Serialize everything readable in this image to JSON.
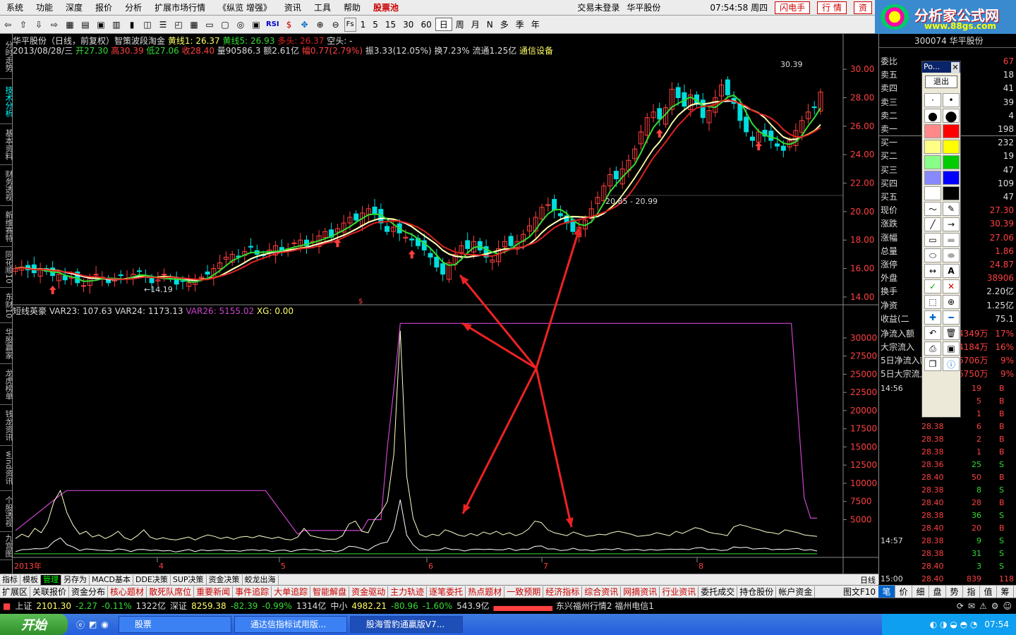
{
  "menubar": {
    "items": [
      "系统",
      "功能",
      "深度",
      "报价",
      "分析",
      "扩展市场行情",
      "《纵览 增强》",
      "资讯",
      "工具",
      "帮助"
    ],
    "highlight": "股票池",
    "login": "交易未登录",
    "stock_name": "华平股份",
    "clock": "07:54:58 周四",
    "btn_flash": "闪电手",
    "btn_quote": "行 情",
    "btn_asset": "资"
  },
  "logo": {
    "title": "分析家公式网",
    "url": "www.88gs.com"
  },
  "toolbar": {
    "periods": [
      "1",
      "5",
      "15",
      "30",
      "60",
      "日",
      "周",
      "月",
      "N",
      "多",
      "季",
      "年"
    ],
    "selected": "日",
    "rsi": "RSI",
    "fs": "Fs"
  },
  "left_tabs": [
    "分时走势",
    "技术分析",
    "基本资料",
    "财务透视",
    "新维赛特",
    "同花顺10",
    "东财10",
    "华股赢家",
    "龙虎榜单",
    "钱龙资讯",
    "wind资讯",
    "个股透视",
    "九宫图"
  ],
  "main_info": {
    "line1_prefix": "华平股份（日线，前复权）智策波段淘金",
    "huang1": "黄线1: 26.37",
    "huang5": "黄线5: 26.93",
    "duotou": "多头: 26.37",
    "kongtou": "空头: -",
    "date": "2013/08/28/三",
    "open": "开27.30",
    "high": "高30.39",
    "low": "低27.06",
    "close": "收28.40",
    "vol": "量90586.3",
    "amount": "额2.61亿",
    "change": "幅0.77(2.79%)",
    "amp": "振3.33(12.05%)",
    "turnover": "换7.23%",
    "float": "流通1.25亿",
    "industry": "通信设备"
  },
  "sub_info": {
    "name": "短线英豪",
    "var23": "VAR23: 107.63",
    "var24": "VAR24: 1173.13",
    "var26": "VAR26: 5155.02",
    "xg": "XG: 0.00"
  },
  "annotations": {
    "peak": "30.39",
    "low1": "14.19",
    "range": "20.85 - 20.99"
  },
  "colors": {
    "yellow": "#ffff66",
    "green": "#33dd33",
    "red": "#dd2222",
    "white": "#ffffff",
    "magenta": "#cc44cc",
    "up": "#ff4040",
    "down": "#00dddd",
    "arrow": "#ee2222"
  },
  "chart_data": [
    {
      "type": "candlestick",
      "title": "华平股份（日线，前复权）",
      "ylim": [
        13.5,
        31
      ],
      "y_ticks": [
        "14.00",
        "16.00",
        "18.00",
        "20.00",
        "22.00",
        "24.00",
        "26.00",
        "28.00",
        "30.00"
      ],
      "x_labels": [
        "2013年",
        "4",
        "5",
        "6",
        "7",
        "8"
      ],
      "closes": [
        16.0,
        16.1,
        15.9,
        15.7,
        16.0,
        15.8,
        15.5,
        15.6,
        15.2,
        15.4,
        15.0,
        14.8,
        15.3,
        15.6,
        15.4,
        15.0,
        15.2,
        15.5,
        15.3,
        15.6,
        15.8,
        15.4,
        15.0,
        15.2,
        15.6,
        15.3,
        14.9,
        15.1,
        15.0,
        15.2,
        15.4,
        15.6,
        16.0,
        16.4,
        16.8,
        17.0,
        16.8,
        17.2,
        17.5,
        17.0,
        16.9,
        17.3,
        17.6,
        17.2,
        17.4,
        17.8,
        18.0,
        17.6,
        17.9,
        18.3,
        18.6,
        18.2,
        18.8,
        19.2,
        19.6,
        19.4,
        19.9,
        20.2,
        19.8,
        19.2,
        18.6,
        18.9,
        18.5,
        18.2,
        18.0,
        17.6,
        17.3,
        16.8,
        16.1,
        15.6,
        16.4,
        17.0,
        17.6,
        17.4,
        17.9,
        17.3,
        16.8,
        16.6,
        17.4,
        17.9,
        17.6,
        17.9,
        18.4,
        19.0,
        19.6,
        20.3,
        20.5,
        20.1,
        19.7,
        19.2,
        18.6,
        18.9,
        19.4,
        20.2,
        21.0,
        21.8,
        22.6,
        22.3,
        23.0,
        23.6,
        24.4,
        25.6,
        26.6,
        27.0,
        26.5,
        27.3,
        28.6,
        28.0,
        27.4,
        28.2,
        27.6,
        26.6,
        27.1,
        28.0,
        28.9,
        28.2,
        27.6,
        26.4,
        25.6,
        25.0,
        25.6,
        25.3,
        25.0,
        24.6,
        24.3,
        25.0,
        25.7,
        26.4,
        27.0,
        27.3,
        28.4
      ],
      "series": [
        {
          "name": "黄线1",
          "values_ref": "ma_yellow"
        },
        {
          "name": "黄线5",
          "values_ref": "ma_green"
        },
        {
          "name": "多头",
          "values_ref": "ma_red"
        }
      ]
    },
    {
      "type": "line",
      "title": "短线英豪",
      "ylim": [
        0,
        33000
      ],
      "y_ticks": [
        "5000",
        "7500",
        "10000",
        "12500",
        "15000",
        "17500",
        "20000",
        "22500",
        "25000",
        "27500",
        "30000"
      ],
      "series": [
        {
          "name": "VAR23",
          "values": [
            2400,
            3000,
            2600,
            3800,
            3200,
            4600,
            7500,
            9000,
            6000,
            4200,
            3000,
            3400,
            2600,
            2900,
            2400,
            2800,
            3400,
            2500,
            2200,
            2800,
            3600,
            2600,
            2300,
            2500,
            2300,
            2200,
            2400,
            2600,
            2200,
            2600,
            2900,
            2700,
            2400,
            2600,
            2300,
            2600,
            2700,
            2500,
            2800,
            2600,
            2400,
            2600,
            2300,
            2200,
            2600,
            3800,
            2800,
            2600,
            2400,
            2300,
            2300,
            2800,
            4400,
            4800,
            3400,
            3200,
            5000,
            6000,
            7500,
            14000,
            31000,
            11000,
            5200,
            3000,
            2600,
            3000,
            2800,
            3600,
            3300,
            2900,
            2700,
            3100,
            2800,
            3300,
            3000,
            3400,
            2900,
            3200,
            2800,
            3100,
            3700,
            4800,
            4600,
            3600,
            3200,
            3000,
            2800,
            3300,
            3000,
            2700,
            2800,
            3000,
            2900,
            3200,
            3400,
            3200,
            3000,
            2700,
            2800,
            2900,
            3200,
            3000,
            2800,
            3400,
            3100,
            3500,
            3900,
            3700,
            3300,
            3100,
            3000,
            2800,
            4000,
            4300,
            4100,
            3800,
            3600,
            3300,
            3200,
            3000,
            3600,
            3400,
            3200,
            2900,
            2800,
            2700
          ]
        },
        {
          "name": "VAR24",
          "values_ref": "var24"
        },
        {
          "name": "VAR26",
          "values_ref": "var26"
        }
      ]
    }
  ],
  "right_panel": {
    "code": "300074",
    "name": "华平股份",
    "rows": [
      {
        "label": "委比",
        "value": "67",
        "color": "#ff4040"
      },
      {
        "label": "卖五",
        "value": "18",
        "color": "#ddd"
      },
      {
        "label": "卖四",
        "value": "41",
        "color": "#ddd"
      },
      {
        "label": "卖三",
        "value": "39",
        "color": "#ddd"
      },
      {
        "label": "卖二",
        "value": "4",
        "color": "#ddd"
      },
      {
        "label": "卖一",
        "value": "198",
        "color": "#ddd"
      },
      {
        "label": "买一",
        "value": "232",
        "color": "#ddd"
      },
      {
        "label": "买二",
        "value": "19",
        "color": "#ddd"
      },
      {
        "label": "买三",
        "value": "47",
        "color": "#ddd"
      },
      {
        "label": "买四",
        "value": "109",
        "color": "#ddd"
      },
      {
        "label": "买五",
        "value": "47",
        "color": "#ddd"
      },
      {
        "label": "现价",
        "value": "27.30",
        "color": "#ff4040"
      },
      {
        "label": "涨跌",
        "value": "30.39",
        "color": "#ff4040"
      },
      {
        "label": "涨幅",
        "value": "27.06",
        "color": "#ff4040"
      },
      {
        "label": "总量",
        "value": "1.86",
        "color": "#ff4040"
      },
      {
        "label": "涨停",
        "value": "24.87",
        "color": "#ff4040"
      },
      {
        "label": "外盘",
        "value": "38906",
        "color": "#ff4040"
      },
      {
        "label": "换手",
        "value": "2.20亿",
        "color": "#ddd"
      },
      {
        "label": "净资",
        "value": "1.25亿",
        "color": "#ddd"
      },
      {
        "label": "收益(二",
        "value": "75.1",
        "color": "#ddd"
      }
    ],
    "flows": [
      {
        "label": "净流入额",
        "value": "4349万",
        "pct": "17%"
      },
      {
        "label": "大宗流入",
        "value": "4184万",
        "pct": "16%"
      },
      {
        "label": "5日净流入额",
        "value": "6706万",
        "pct": "9%"
      },
      {
        "label": "5日大宗流入",
        "value": "6750万",
        "pct": "9%"
      }
    ],
    "ticks": [
      {
        "t": "14:56",
        "p": "",
        "v": "19",
        "s": "B"
      },
      {
        "t": "",
        "p": "",
        "v": "5",
        "s": "B"
      },
      {
        "t": "",
        "p": "",
        "v": "1",
        "s": "B"
      },
      {
        "t": "",
        "p": "28.38",
        "v": "6",
        "s": "B"
      },
      {
        "t": "",
        "p": "28.38",
        "v": "2",
        "s": "B"
      },
      {
        "t": "",
        "p": "28.38",
        "v": "1",
        "s": "B"
      },
      {
        "t": "",
        "p": "28.36",
        "v": "25",
        "s": "S"
      },
      {
        "t": "",
        "p": "28.40",
        "v": "50",
        "s": "B"
      },
      {
        "t": "",
        "p": "28.38",
        "v": "8",
        "s": "S"
      },
      {
        "t": "",
        "p": "28.40",
        "v": "28",
        "s": "B"
      },
      {
        "t": "",
        "p": "28.38",
        "v": "36",
        "s": "S"
      },
      {
        "t": "",
        "p": "28.40",
        "v": "20",
        "s": "B"
      },
      {
        "t": "14:57",
        "p": "28.38",
        "v": "9",
        "s": "S"
      },
      {
        "t": "",
        "p": "28.38",
        "v": "31",
        "s": "S"
      },
      {
        "t": "",
        "p": "28.40",
        "v": "3",
        "s": "S"
      },
      {
        "t": "15:00",
        "p": "28.40",
        "v": "839",
        "s": "118"
      }
    ]
  },
  "drawing_tool": {
    "title": "Po...",
    "exit": "退出"
  },
  "bottom_tabs": [
    "指标",
    "模板",
    "管理",
    "另存为",
    "MACD基本",
    "DDE决策",
    "SUP决策",
    "资金决策",
    "蛟龙出海"
  ],
  "bottom_tabs_selected": "管理",
  "period_label": "日线",
  "func_bar": [
    "扩展区",
    "关联报价",
    "资金分布",
    "核心题材",
    "散死队席位",
    "重要新闻",
    "事件追踪",
    "大单追踪",
    "智能解盘",
    "资金驱动",
    "主力轨迹",
    "逐笔委托",
    "热点题材",
    "一致预期",
    "经济指标",
    "综合资讯",
    "网摘资讯",
    "行业资讯",
    "委托成交",
    "持仓股份",
    "帐户资金"
  ],
  "func_bar_red": [
    "核心题材",
    "散死队席位",
    "重要新闻",
    "事件追踪",
    "大单追踪",
    "智能解盘",
    "资金驱动",
    "主力轨迹",
    "逐笔委托",
    "热点题材",
    "一致预期",
    "经济指标",
    "综合资讯",
    "网摘资讯",
    "行业资讯"
  ],
  "right_bottom_tabs": [
    "笔",
    "价",
    "细",
    "盘",
    "势",
    "指",
    "值",
    "筹"
  ],
  "status": {
    "sh_label": "上证",
    "sh_val": "2101.30",
    "sh_chg": "-2.27",
    "sh_pct": "-0.11%",
    "sh_amt": "1322亿",
    "sz_label": "深证",
    "sz_val": "8259.38",
    "sz_chg": "-82.39",
    "sz_pct": "-0.99%",
    "sz_amt": "1314亿",
    "zx_label": "中小",
    "zx_val": "4982.21",
    "zx_chg": "-80.96",
    "zx_pct": "-1.60%",
    "zx_amt": "543.9亿",
    "server": "东兴福州行情2 福州电信1",
    "view_label": "图文F10"
  },
  "taskbar": {
    "start": "开始",
    "tasks": [
      "股票",
      "通达信指标试用版...",
      "股海雪豹通赢版V7..."
    ],
    "time": "07:54"
  }
}
